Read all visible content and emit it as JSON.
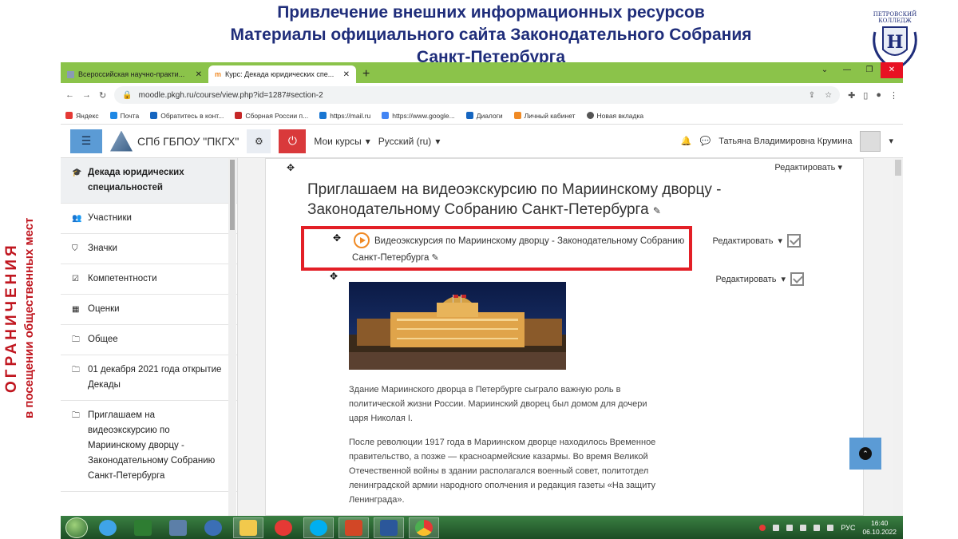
{
  "slide": {
    "title_line1": "Привлечение внешних информационных ресурсов",
    "title_line2": "Материалы официального сайта Законодательного Собрания",
    "title_line3": "Санкт-Петербурга",
    "vertical_caption_1": "ОГРАНИЧЕНИЯ",
    "vertical_caption_2": "в посещении общественных мест",
    "logo_text": "ПЕТРОВСКИЙ КОЛЛЕДЖ",
    "accent_color": "#c0161f",
    "title_color": "#1f2d7a"
  },
  "browser": {
    "tabs": [
      {
        "label": "Всероссийская научно-практи...",
        "active": false
      },
      {
        "label": "Курс: Декада юридических спе...",
        "active": true
      }
    ],
    "url": "moodle.pkgh.ru/course/view.php?id=1287#section-2",
    "bookmarks": [
      {
        "label": "Яндекс",
        "color": "#e53935"
      },
      {
        "label": "Почта",
        "color": "#1e88e5"
      },
      {
        "label": "Обратитесь в конт...",
        "color": "#1565c0"
      },
      {
        "label": "Сборная России п...",
        "color": "#c62828"
      },
      {
        "label": "https://mail.ru",
        "color": "#1976d2"
      },
      {
        "label": "https://www.google...",
        "color": "#4285f4"
      },
      {
        "label": "Диалоги",
        "color": "#1565c0"
      },
      {
        "label": "Личный кабинет",
        "color": "#f08a24"
      },
      {
        "label": "Новая вкладка",
        "color": "#555555"
      }
    ]
  },
  "navbar": {
    "site_name": "СПб ГБПОУ \"ПКГХ\"",
    "my_courses": "Мои курсы",
    "language": "Русский (ru)",
    "user_name": "Татьяна Владимировна Крумина"
  },
  "sidebar": {
    "items": [
      {
        "label": "Декада юридических специальностей",
        "icon": "graduation-cap-icon",
        "glyph": "🎓",
        "active": true
      },
      {
        "label": "Участники",
        "icon": "users-icon",
        "glyph": "👥",
        "active": false
      },
      {
        "label": "Значки",
        "icon": "shield-icon",
        "glyph": "⛉",
        "active": false
      },
      {
        "label": "Компетентности",
        "icon": "checkbox-icon",
        "glyph": "☑",
        "active": false
      },
      {
        "label": "Оценки",
        "icon": "table-icon",
        "glyph": "▦",
        "active": false
      },
      {
        "label": "Общее",
        "icon": "folder-icon",
        "glyph": "🗀",
        "active": false
      },
      {
        "label": "01 декабря 2021 года открытие Декады",
        "icon": "folder-icon",
        "glyph": "🗀",
        "active": false
      },
      {
        "label": "Приглашаем на видеоэкскурсию по Мариинскому дворцу - Законодательному Собранию Санкт-Петербурга",
        "icon": "folder-icon",
        "glyph": "🗀",
        "active": false
      }
    ]
  },
  "main": {
    "edit_label": "Редактировать",
    "section_title": "Приглашаем на видеоэкскурсию по Мариинскому дворцу - Законодательному Собранию Санкт-Петербурга",
    "activity_title": "Видеоэкскурсия по Мариинскому дворцу - Законодательному Собранию Санкт-Петербурга",
    "paragraph1": "Здание Мариинского дворца в Петербурге сыграло важную роль в политической жизни России. Мариинский дворец был домом для дочери царя Николая I.",
    "paragraph2": "После революции 1917 года в Мариинском дворце находилось Временное правительство, а позже — красноармейские казармы. Во время Великой Отечественной войны в здании располагался военный совет, политотдел ленинградской армии народного ополчения и редакция газеты «На защиту Ленинграда»."
  },
  "taskbar": {
    "language": "РУС",
    "time": "16:40",
    "date": "06.10.2022",
    "apps": [
      {
        "name": "ie-icon",
        "color": "#3fa4e8",
        "open": false
      },
      {
        "name": "store-icon",
        "color": "#2e7d32",
        "open": false
      },
      {
        "name": "monitor-icon",
        "color": "#5c7fa8",
        "open": false
      },
      {
        "name": "remote-icon",
        "color": "#3b6fb6",
        "open": false
      },
      {
        "name": "explorer-icon",
        "color": "#f2c94c",
        "open": true
      },
      {
        "name": "yandex-icon",
        "color": "#e53935",
        "open": false
      },
      {
        "name": "skype-icon",
        "color": "#00aff0",
        "open": true
      },
      {
        "name": "powerpoint-icon",
        "color": "#d24726",
        "open": true
      },
      {
        "name": "word-icon",
        "color": "#2b579a",
        "open": true
      },
      {
        "name": "chrome-icon",
        "color": "#4caf50",
        "open": true
      }
    ]
  }
}
